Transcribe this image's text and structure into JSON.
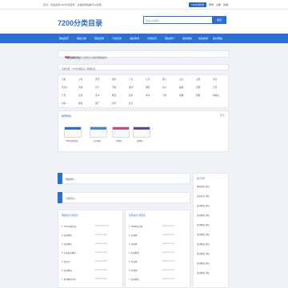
{
  "topbar": {
    "message": "您好，欢迎来到7200分类目录，这里的网站都可以收录。",
    "badge": "7200分类目录",
    "links": [
      "登录",
      "注册",
      "投稿"
    ]
  },
  "header": {
    "logo": "7200分类目录",
    "search_placeholder": "请输入关键词",
    "search_button": "搜索"
  },
  "nav": [
    "网站首页",
    "网站分类",
    "网站目录",
    "分类目录",
    "最新收录",
    "文章资讯",
    "网站排行",
    "最新更新",
    "快速收录",
    "提交网站"
  ],
  "notice": {
    "prefix": "本站已收录",
    "count1": "47",
    "mid": "个网站，今日收录",
    "count2": "2033",
    "suffix": "个站点 网站目录，分类目录以及其他网站推荐。"
  },
  "breadcrumb": "当前位置：7200分类目录 » 网站目录",
  "categories": [
    [
      "分类",
      "上海",
      "天津",
      "重庆",
      "广东",
      "江苏",
      "浙江",
      "山东",
      "山西",
      "河北"
    ],
    [
      "黑龙江",
      "吉林",
      "辽宁",
      "河南",
      "湖北",
      "湖南",
      "四川",
      "福建",
      "安徽",
      "江西"
    ],
    [
      "广西",
      "云南",
      "贵州",
      "陕西",
      "甘肃",
      "青海",
      "宁夏",
      "新疆",
      "西藏",
      "内蒙古"
    ],
    [
      "海南",
      "香港",
      "澳门",
      "台湾",
      "北京"
    ]
  ],
  "recommend": {
    "title": "推荐网站",
    "more": "更多",
    "items": [
      "7200分类目录",
      "山东网站",
      "好网站",
      "某网站"
    ]
  },
  "stripes": [
    "网站推荐 »",
    "分类目录 »"
  ],
  "lists": [
    {
      "title": "网络站长分类目录",
      "rows": [
        {
          "name": "1. 7200分类目录",
          "domain": "www.7200.com"
        },
        {
          "name": "2. 某某网站",
          "domain": "www.xxx.com"
        },
        {
          "name": "3. 某某网址",
          "domain": "www.xxx.com"
        },
        {
          "name": "4. 分类目录网站",
          "domain": "www.xxx.com"
        },
        {
          "name": "5. 某某店",
          "domain": "www.xxx.com"
        },
        {
          "name": "6. 某某网站",
          "domain": "www.xxx.com"
        },
        {
          "name": "7. 目录网站导航",
          "domain": "www.xxx.com"
        }
      ]
    },
    {
      "title": "优质站点分类目录",
      "rows": [
        {
          "name": "1. 360网址之家",
          "domain": "www.xxx.com"
        },
        {
          "name": "2. 某某网",
          "domain": "www.xxx.com"
        },
        {
          "name": "3. 某某网",
          "domain": "www.xxx.com"
        },
        {
          "name": "4. 某某网站",
          "domain": "www.xxx.com"
        },
        {
          "name": "5. 某某网",
          "domain": "www.xxx.com"
        },
        {
          "name": "6. 某某网",
          "domain": "www.xxx.com"
        },
        {
          "name": "7. 某某网站",
          "domain": "www.xxx.com"
        }
      ]
    }
  ],
  "side": {
    "title": "热门排行",
    "rows": [
      "网站目录 排名",
      "分类目录 排名",
      "目录网站 排名",
      "目录网站 排名",
      "目录网站 排名",
      "目录网站 排名",
      "目录网站 排名",
      "目录网站 排名",
      "目录网站 排名",
      "目录网站 排名"
    ]
  }
}
